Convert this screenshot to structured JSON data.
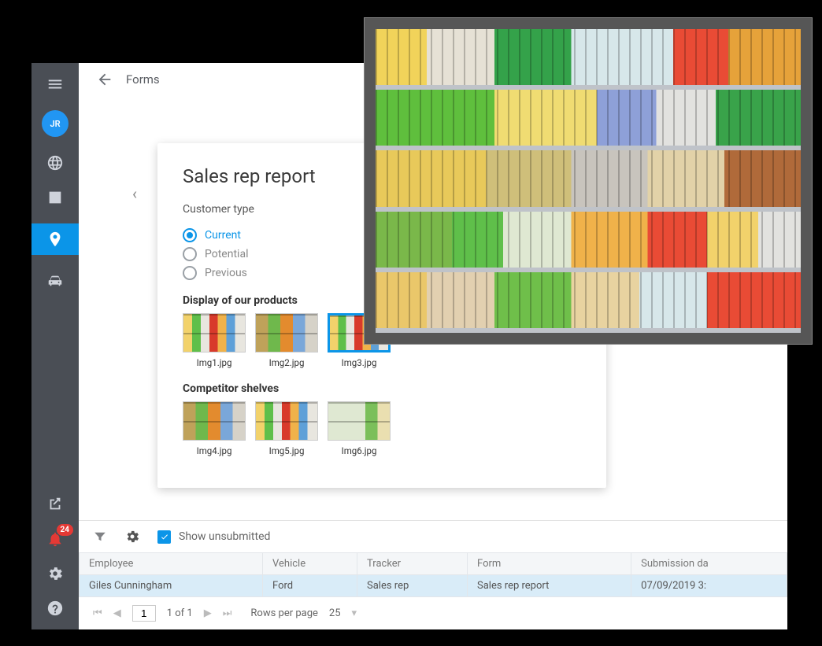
{
  "sidebar": {
    "avatar_initials": "JR",
    "notification_count": "24"
  },
  "header": {
    "back_label": "Forms"
  },
  "form_card": {
    "title": "Sales rep report",
    "customer_type_label": "Customer type",
    "options": [
      "Current",
      "Potential",
      "Previous"
    ],
    "selected_option": "Current",
    "section_products": "Display of our products",
    "product_thumbs": [
      "Img1.jpg",
      "Img2.jpg",
      "Img3.jpg"
    ],
    "selected_product_thumb": "Img3.jpg",
    "section_competitors": "Competitor shelves",
    "competitor_thumbs": [
      "Img4.jpg",
      "Img5.jpg",
      "Img6.jpg"
    ]
  },
  "muted": {
    "title_fragment": "ts",
    "file_fragment": "g"
  },
  "bottom": {
    "show_unsubmitted_label": "Show unsubmitted",
    "columns": [
      "Employee",
      "Vehicle",
      "Tracker",
      "Form",
      "Submission da"
    ],
    "row": {
      "employee": "Giles Cunningham",
      "vehicle": "Ford",
      "tracker": "Sales rep",
      "form": "Sales rep report",
      "submission": "07/09/2019 3:"
    },
    "pager": {
      "position": "1 of 1",
      "rows_label": "Rows per page",
      "rows_value": "25"
    }
  }
}
